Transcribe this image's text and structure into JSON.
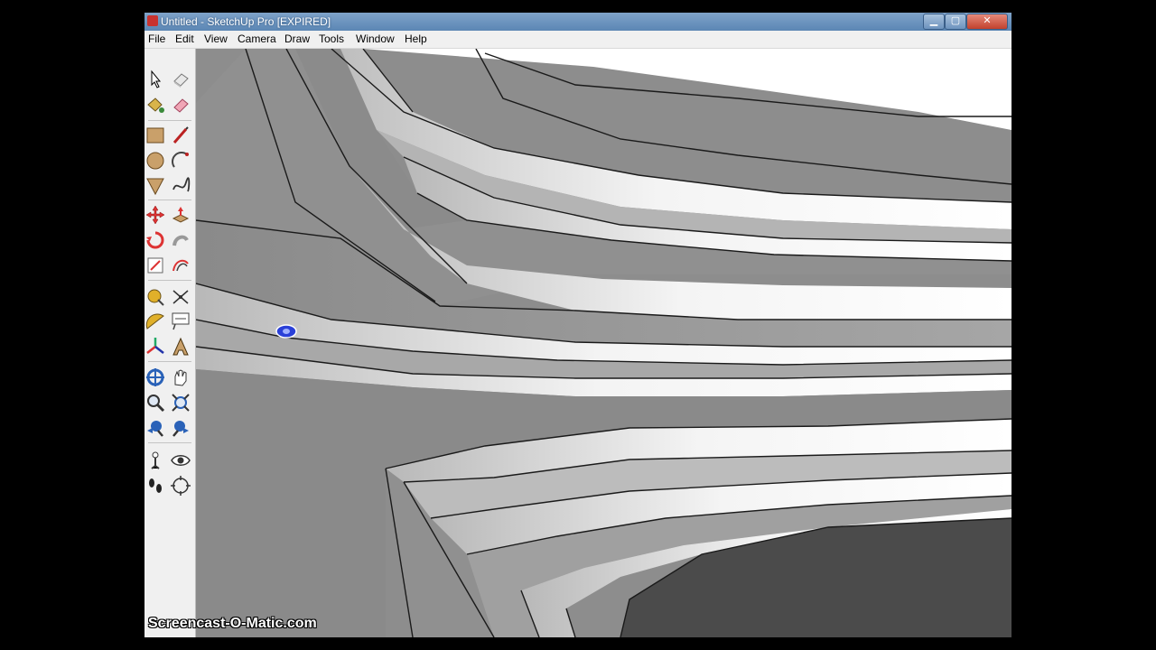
{
  "window": {
    "title": "Untitled - SketchUp Pro [EXPIRED]"
  },
  "menubar": {
    "items": [
      {
        "label": "File"
      },
      {
        "label": "Edit"
      },
      {
        "label": "View"
      },
      {
        "label": "Camera"
      },
      {
        "label": "Draw"
      },
      {
        "label": "Tools"
      },
      {
        "label": "Window"
      },
      {
        "label": "Help"
      }
    ]
  },
  "toolbar": {
    "tools": [
      "select-icon",
      "eraser-icon",
      "paint-bucket-icon",
      "erase-brush-icon",
      "rectangle-icon",
      "line-icon",
      "circle-icon",
      "arc-icon",
      "polygon-icon",
      "freehand-icon",
      "move-icon",
      "push-pull-icon",
      "rotate-icon",
      "follow-me-icon",
      "scale-icon",
      "offset-icon",
      "tape-measure-icon",
      "dimension-icon",
      "protractor-icon",
      "text-icon",
      "axes-icon",
      "3d-text-icon",
      "orbit-icon",
      "pan-icon",
      "zoom-icon",
      "zoom-extents-icon",
      "previous-view-icon",
      "next-view-icon",
      "position-camera-icon",
      "look-around-icon",
      "walk-icon",
      "section-plane-icon"
    ]
  },
  "watermark": {
    "text": "Screencast-O-Matic.com"
  }
}
